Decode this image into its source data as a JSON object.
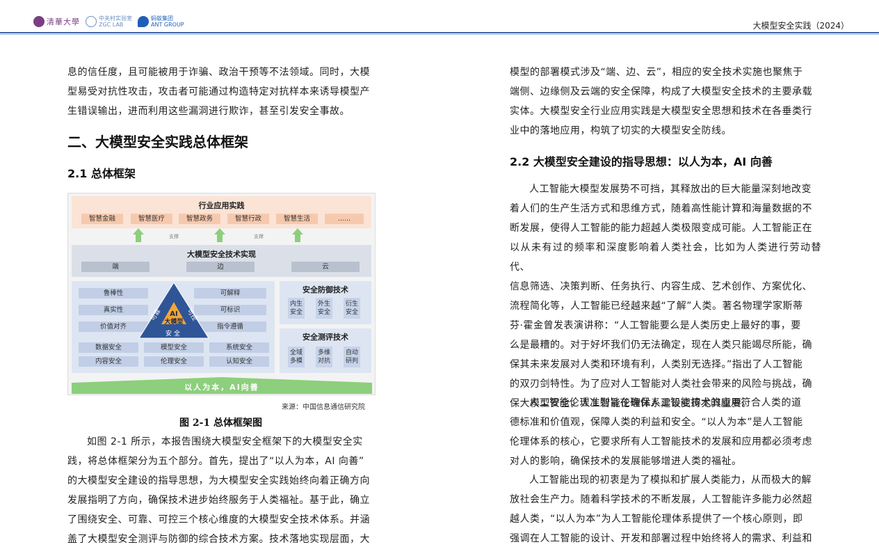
{
  "header": {
    "logos": {
      "tsinghua": "清華大學",
      "zgc_cn": "中关村实验室",
      "zgc_en": "ZGC LAB",
      "ant_cn": "蚂蚁集团",
      "ant_en": "ANT GROUP"
    },
    "title": "大模型安全实践（2024）"
  },
  "left": {
    "intro_lines": [
      "息的信任度，且可能被用于诈骗、政治干预等不法领域。同时，大模",
      "型易受对抗性攻击，攻击者可能通过构造特定对抗样本来诱导模型产",
      "生错误输出，进而利用这些漏洞进行欺诈，甚至引发安全事故。"
    ],
    "section_title": "二、大模型安全实践总体框架",
    "subsection_title": "2.1 总体框架",
    "figure": {
      "industry_title": "行业应用实践",
      "industry_items": [
        "智慧金融",
        "智慧医疗",
        "智慧政务",
        "智慧行政",
        "智慧生活",
        "......"
      ],
      "support_label_1": "支撑",
      "support_label_2": "支撑",
      "tech_title": "大模型安全技术实现",
      "tech_items": [
        "端",
        "边",
        "云"
      ],
      "left_items": [
        "鲁棒性",
        "真实性",
        "价值对齐"
      ],
      "right_items": [
        "可解释",
        "可标识",
        "指令遵循"
      ],
      "triangle": {
        "top_left": "可靠",
        "top_right": "可控",
        "center_1": "AI",
        "center_2": "大模型",
        "bottom": "安全"
      },
      "bottom_items": [
        [
          "数据安全",
          "模型安全",
          "系统安全"
        ],
        [
          "内容安全",
          "伦理安全",
          "认知安全"
        ]
      ],
      "defense_title": "安全防御技术",
      "defense_items": [
        [
          "内生",
          "安全"
        ],
        [
          "外生",
          "安全"
        ],
        [
          "衍生",
          "安全"
        ]
      ],
      "eval_title": "安全测评技术",
      "eval_items": [
        [
          "全域",
          "多模"
        ],
        [
          "多维",
          "对抗"
        ],
        [
          "自动",
          "研判"
        ]
      ],
      "banner": "以人为本，AI向善",
      "source": "来源：中国信息通信研究院",
      "caption": "图 2-1 总体框架图"
    },
    "body_lines": [
      "如图 2-1 所示，本报告围绕大模型安全框架下的大模型安全实",
      "践，将总体框架分为五个部分。首先，提出了“以人为本，AI 向善”",
      "的大模型安全建设的指导思想，为大模型安全实践始终向着正确方向",
      "发展指明了方向，确保技术进步始终服务于人类福祉。基于此，确立",
      "了围绕安全、可靠、可控三个核心维度的大模型安全技术体系。并涵",
      "盖了大模型安全测评与防御的综合技术方案。技术落地实现层面，大"
    ]
  },
  "right": {
    "intro_lines": [
      "模型的部署模式涉及“端、边、云”，相应的安全技术实施也聚焦于",
      "端侧、边缘侧及云端的安全保障，构成了大模型安全技术的主要承载",
      "实体。大模型安全行业应用实践是大模型安全思想和技术在各垂类行",
      "业中的落地应用，构筑了切实的大模型安全防线。"
    ],
    "subsection_title": "2.2 大模型安全建设的指导思想：以人为本，AI 向善",
    "para1_lines": [
      "人工智能大模型发展势不可挡，其释放出的巨大能量深刻地改变",
      "着人们的生产生活方式和思维方式，随着高性能计算和海量数据的不",
      "断发展，使得人工智能的能力超越人类极限变成可能。人工智能正在",
      "以从未有过的频率和深度影响着人类社会，比如为人类进行劳动替代、",
      "信息筛选、决策判断、任务执行、内容生成、艺术创作、方案优化、",
      "流程简化等，人工智能已经越来越“了解”人类。著名物理学家斯蒂",
      "芬·霍金曾发表演讲称：“人工智能要么是人类历史上最好的事，要",
      "么是最糟的。对于好坏我们仍无法确定，现在人类只能竭尽所能，确",
      "保其未来发展对人类和环境有利，人类别无选择。”指出了人工智能",
      "的双刃剑特性。为了应对人工智能对人类社会带来的风险与挑战，确",
      "保大模型安全，人工智能伦理体系建设变得尤其重要。"
    ],
    "para2_lines": [
      "人工智能伦理准则旨在确保人工智能技术的应用符合人类的道",
      "德标准和价值观，保障人类的利益和安全。“以人为本”是人工智能",
      "伦理体系的核心，它要求所有人工智能技术的发展和应用都必须考虑",
      "对人的影响，确保技术的发展能够增进人类的福祉。"
    ],
    "para3_lines": [
      "人工智能出现的初衷是为了模拟和扩展人类能力，从而极大的解",
      "放社会生产力。随着科学技术的不断发展，人工智能许多能力必然超",
      "越人类，“以人为本”为人工智能伦理体系提供了一个核心原则，即",
      "强调在人工智能的设计、开发和部署过程中始终将人的需求、利益和"
    ]
  }
}
